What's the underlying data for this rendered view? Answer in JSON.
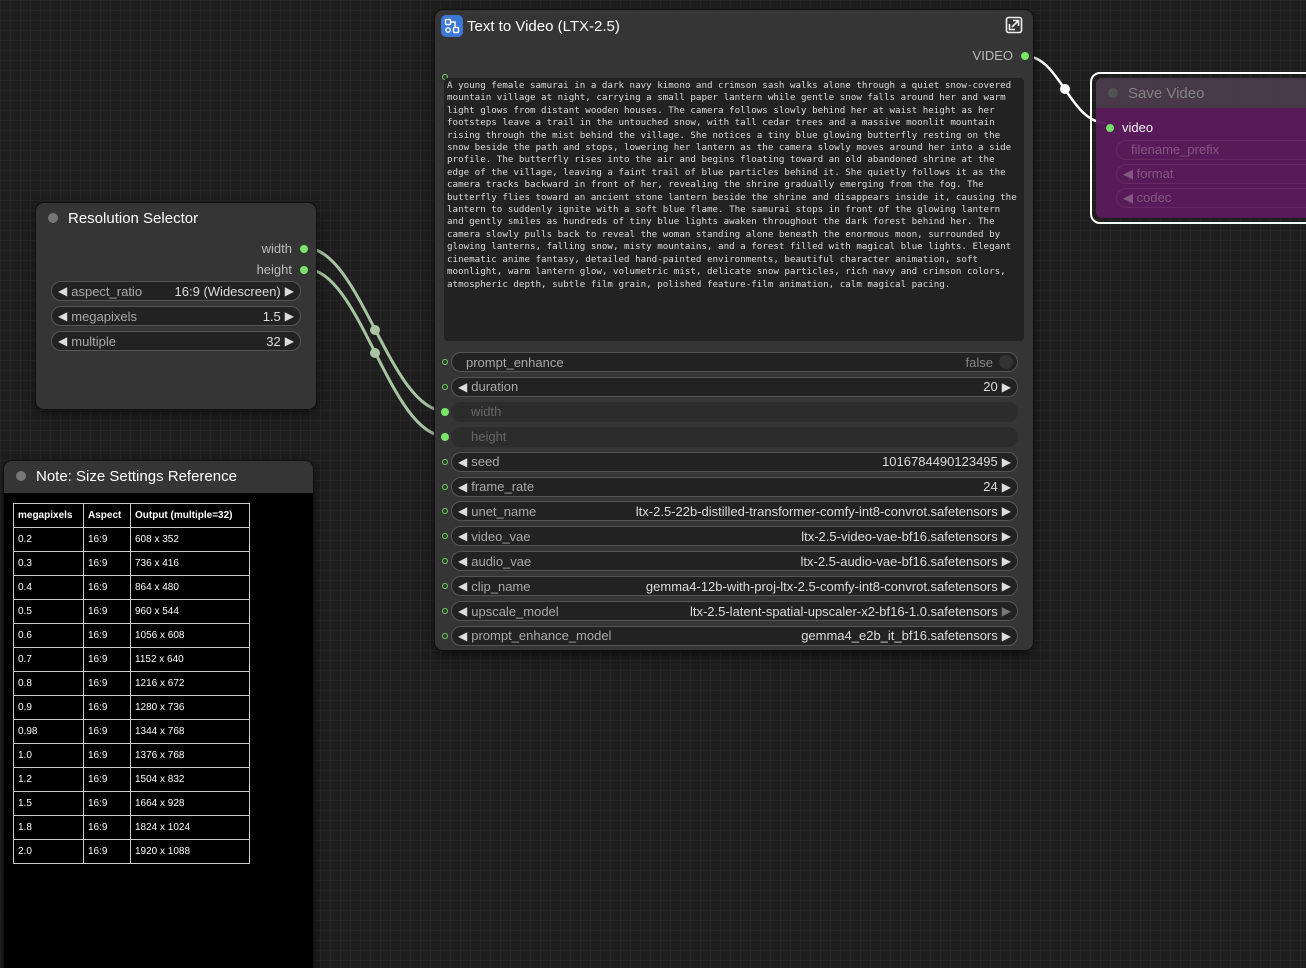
{
  "resolution_node": {
    "title": "Resolution Selector",
    "outputs": [
      "width",
      "height"
    ],
    "widgets": [
      {
        "label": "aspect_ratio",
        "value": "16:9 (Widescreen)"
      },
      {
        "label": "megapixels",
        "value": "1.5"
      },
      {
        "label": "multiple",
        "value": "32"
      }
    ]
  },
  "note_node": {
    "title": "Note: Size Settings Reference",
    "headers": [
      "megapixels",
      "Aspect",
      "Output (multiple=32)"
    ],
    "rows": [
      [
        "0.2",
        "16:9",
        "608 x 352"
      ],
      [
        "0.3",
        "16:9",
        "736 x 416"
      ],
      [
        "0.4",
        "16:9",
        "864 x 480"
      ],
      [
        "0.5",
        "16:9",
        "960 x 544"
      ],
      [
        "0.6",
        "16:9",
        "1056 x 608"
      ],
      [
        "0.7",
        "16:9",
        "1152 x 640"
      ],
      [
        "0.8",
        "16:9",
        "1216 x 672"
      ],
      [
        "0.9",
        "16:9",
        "1280 x 736"
      ],
      [
        "0.98",
        "16:9",
        "1344 x 768"
      ],
      [
        "1.0",
        "16:9",
        "1376 x 768"
      ],
      [
        "1.2",
        "16:9",
        "1504 x 832"
      ],
      [
        "1.5",
        "16:9",
        "1664 x 928"
      ],
      [
        "1.8",
        "16:9",
        "1824 x 1024"
      ],
      [
        "2.0",
        "16:9",
        "1920 x 1088"
      ]
    ]
  },
  "t2v_node": {
    "title": "Text to Video (LTX-2.5)",
    "output": "VIDEO",
    "prompt": "A young female samurai in a dark navy kimono and crimson sash walks alone through a quiet snow-covered mountain village at night, carrying a small paper lantern while gentle snow falls around her and warm light glows from distant wooden houses. The camera follows slowly behind her at waist height as her footsteps leave a trail in the untouched snow, with tall cedar trees and a massive moonlit mountain rising through the mist behind the village. She notices a tiny blue glowing butterfly resting on the snow beside the path and stops, lowering her lantern as the camera slowly moves around her into a side profile. The butterfly rises into the air and begins floating toward an old abandoned shrine at the edge of the village, leaving a faint trail of blue particles behind it. She quietly follows it as the camera tracks backward in front of her, revealing the shrine gradually emerging from the fog. The butterfly flies toward an ancient stone lantern beside the shrine and disappears inside it, causing the lantern to suddenly ignite with a soft blue flame. The samurai stops in front of the glowing lantern and gently smiles as hundreds of tiny blue lights awaken throughout the dark forest behind her. The camera slowly pulls back to reveal the woman standing alone beneath the enormous moon, surrounded by glowing lanterns, falling snow, misty mountains, and a forest filled with magical blue lights. Elegant cinematic anime fantasy, detailed hand-painted environments, beautiful character animation, soft moonlight, warm lantern glow, volumetric mist, delicate snow particles, rich navy and crimson colors, atmospheric depth, subtle film grain, polished feature-film animation, calm magical pacing.",
    "widgets": [
      {
        "label": "prompt_enhance",
        "value": "false"
      },
      {
        "label": "duration",
        "value": "20"
      },
      {
        "label": "width",
        "value": ""
      },
      {
        "label": "height",
        "value": ""
      },
      {
        "label": "seed",
        "value": "1016784490123495"
      },
      {
        "label": "frame_rate",
        "value": "24"
      },
      {
        "label": "unet_name",
        "value": "ltx-2.5-22b-distilled-transformer-comfy-int8-convrot.safetensors"
      },
      {
        "label": "video_vae",
        "value": "ltx-2.5-video-vae-bf16.safetensors"
      },
      {
        "label": "audio_vae",
        "value": "ltx-2.5-audio-vae-bf16.safetensors"
      },
      {
        "label": "clip_name",
        "value": "gemma4-12b-with-proj-ltx-2.5-comfy-int8-convrot.safetensors"
      },
      {
        "label": "upscale_model",
        "value": "ltx-2.5-latent-spatial-upscaler-x2-bf16-1.0.safetensors"
      },
      {
        "label": "prompt_enhance_model",
        "value": "gemma4_e2b_it_bf16.safetensors"
      }
    ]
  },
  "save_node": {
    "title": "Save Video",
    "input": "video",
    "widgets": [
      "filename_prefix",
      "format",
      "codec"
    ]
  },
  "colors": {
    "socket_green": "#7ae56a",
    "link_green": "#a9c4a3",
    "save_node_bg": "#5c1a5c"
  }
}
